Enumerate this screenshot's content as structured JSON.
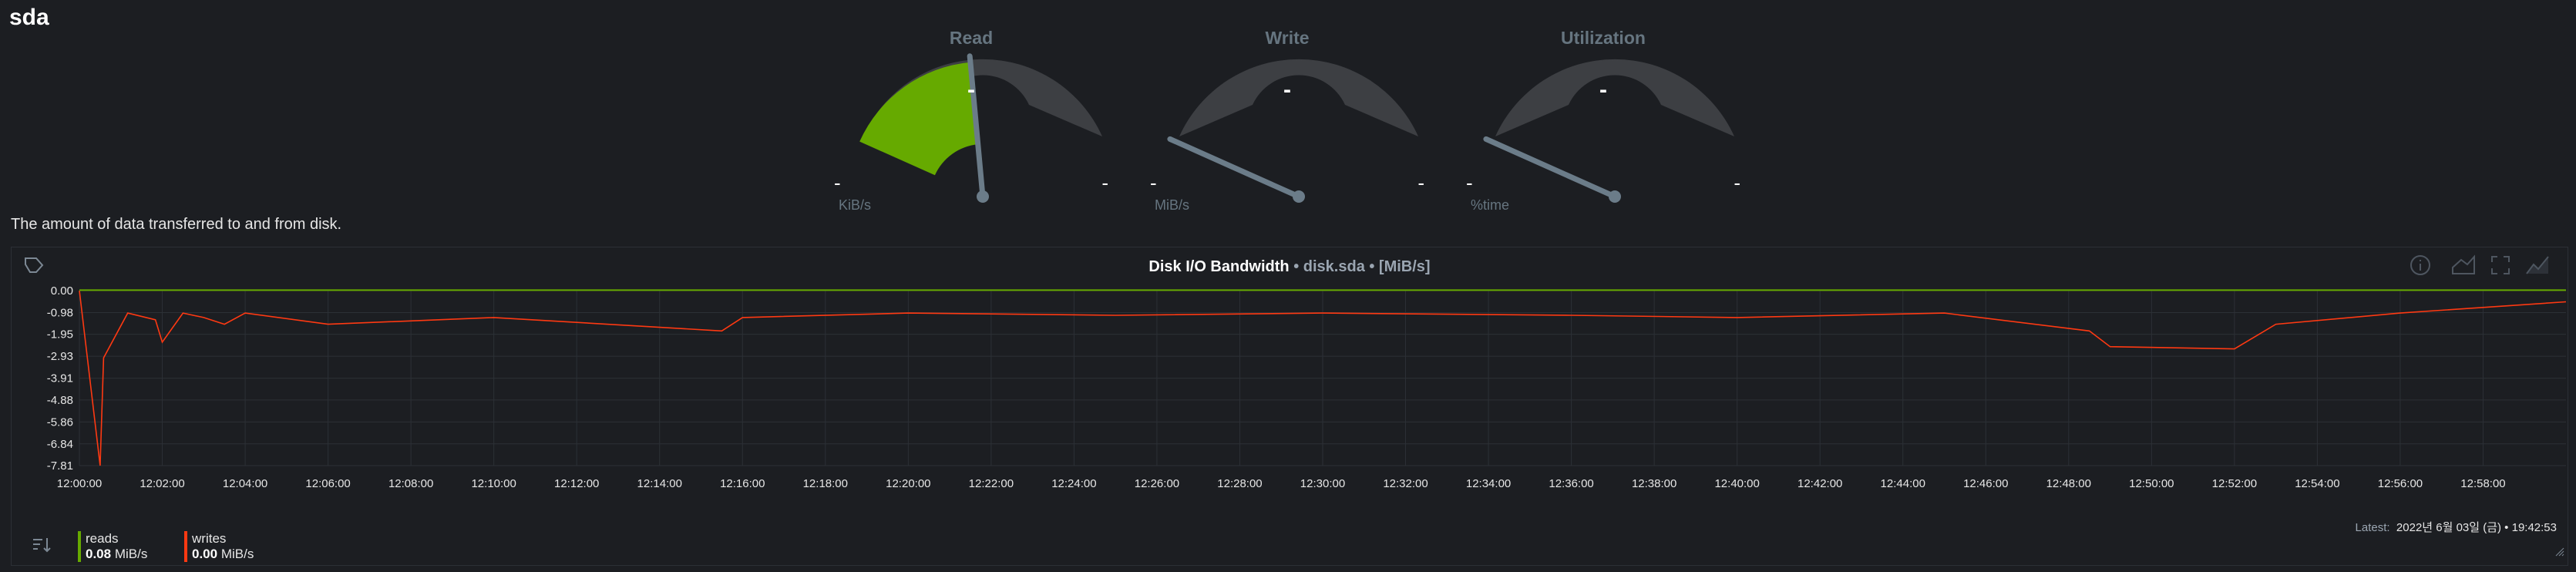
{
  "page": {
    "title": "sda",
    "description": "The amount of data transferred to and from disk."
  },
  "gauges": [
    {
      "title": "Read",
      "value": "-",
      "min": "-",
      "max": "-",
      "unit": "KiB/s",
      "fill_fraction": 0.46,
      "color": "#66aa00"
    },
    {
      "title": "Write",
      "value": "-",
      "min": "-",
      "max": "-",
      "unit": "MiB/s",
      "fill_fraction": 0,
      "color": "#66aa00"
    },
    {
      "title": "Utilization",
      "value": "-",
      "min": "-",
      "max": "-",
      "unit": "%time",
      "fill_fraction": 0,
      "color": "#66aa00"
    }
  ],
  "chart": {
    "title_main": "Disk I/O Bandwidth",
    "title_context": "• disk.sda • [MiB/s]",
    "latest_label": "Latest:",
    "latest_value": "2022년 6월 03일 (금) • 19:42:53",
    "legend": [
      {
        "name": "reads",
        "value": "0.08",
        "unit": "MiB/s",
        "color": "#66aa00"
      },
      {
        "name": "writes",
        "value": "0.00",
        "unit": "MiB/s",
        "color": "#fe3912"
      }
    ]
  },
  "chart_data": {
    "type": "line",
    "title": "Disk I/O Bandwidth",
    "ylabel": "MiB/s",
    "ylim": [
      -7.81,
      0.0
    ],
    "y_ticks": [
      "0.00",
      "-0.98",
      "-1.95",
      "-2.93",
      "-3.91",
      "-4.88",
      "-5.86",
      "-6.84",
      "-7.81"
    ],
    "x_ticks": [
      "12:00:00",
      "12:02:00",
      "12:04:00",
      "12:06:00",
      "12:08:00",
      "12:10:00",
      "12:12:00",
      "12:14:00",
      "12:16:00",
      "12:18:00",
      "12:20:00",
      "12:22:00",
      "12:24:00",
      "12:26:00",
      "12:28:00",
      "12:30:00",
      "12:32:00",
      "12:34:00",
      "12:36:00",
      "12:38:00",
      "12:40:00",
      "12:42:00",
      "12:44:00",
      "12:46:00",
      "12:48:00",
      "12:50:00",
      "12:52:00",
      "12:54:00",
      "12:56:00",
      "12:58:00"
    ],
    "x_range": [
      "12:00:00",
      "13:00:00"
    ],
    "grid": true,
    "series": [
      {
        "name": "reads",
        "color": "#66aa00",
        "x": [
          "12:00:00",
          "13:00:00"
        ],
        "values": [
          0.02,
          0.02
        ]
      },
      {
        "name": "writes",
        "color": "#fe3912",
        "x": [
          "12:00:00",
          "12:00:30",
          "12:00:35",
          "12:01:10",
          "12:01:50",
          "12:02:00",
          "12:02:30",
          "12:03:00",
          "12:03:30",
          "12:04:00",
          "12:06:00",
          "12:10:00",
          "12:15:30",
          "12:16:00",
          "12:20:00",
          "12:25:00",
          "12:30:00",
          "12:36:00",
          "12:40:00",
          "12:45:00",
          "12:48:30",
          "12:49:00",
          "12:52:00",
          "12:53:00",
          "12:56:00",
          "13:00:00"
        ],
        "values": [
          0,
          -7.81,
          -3.0,
          -1.0,
          -1.3,
          -2.3,
          -1.0,
          -1.2,
          -1.5,
          -1.0,
          -1.5,
          -1.2,
          -1.8,
          -1.2,
          -1.0,
          -1.1,
          -1.0,
          -1.1,
          -1.2,
          -1.0,
          -1.8,
          -2.5,
          -2.6,
          -1.5,
          -1.0,
          -0.5
        ]
      }
    ]
  }
}
